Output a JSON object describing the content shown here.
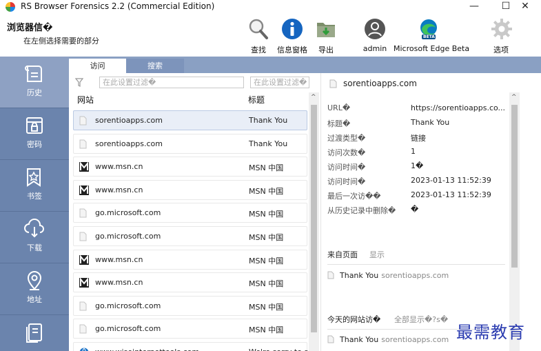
{
  "window": {
    "title": "RS Browser Forensics 2.2 (Commercial Edition)",
    "min_label": "—",
    "max_label": "☐",
    "close_label": "✕"
  },
  "header": {
    "title": "浏览器信�",
    "subtitle": "在左侧选择需要的部分"
  },
  "toolbar": {
    "find": "查找",
    "info_pane": "信息窗格",
    "export": "导出",
    "user": "admin",
    "browser": "Microsoft Edge Beta",
    "options": "选项",
    "browser_badge": "BETA"
  },
  "sidebar": {
    "items": [
      {
        "label": "历史",
        "icon": "history-icon"
      },
      {
        "label": "密码",
        "icon": "password-icon"
      },
      {
        "label": "书签",
        "icon": "bookmark-icon"
      },
      {
        "label": "下载",
        "icon": "download-icon"
      },
      {
        "label": "地址",
        "icon": "location-icon"
      },
      {
        "label": "",
        "icon": "document-icon"
      }
    ]
  },
  "tabs": [
    {
      "label": "访问"
    },
    {
      "label": "搜索"
    }
  ],
  "list": {
    "filter_placeholder_url": "在此设置过滤�",
    "filter_placeholder_title": "在此设置过滤�",
    "col_url": "网站",
    "col_title": "标题",
    "rows": [
      {
        "url": "sorentioapps.com",
        "title": "Thank You",
        "favicon": "blank"
      },
      {
        "url": "sorentioapps.com",
        "title": "Thank You",
        "favicon": "blank"
      },
      {
        "url": "www.msn.cn",
        "title": "MSN 中国",
        "favicon": "msn"
      },
      {
        "url": "www.msn.cn",
        "title": "MSN 中国",
        "favicon": "msn"
      },
      {
        "url": "go.microsoft.com",
        "title": "MSN 中国",
        "favicon": "blank"
      },
      {
        "url": "go.microsoft.com",
        "title": "MSN 中国",
        "favicon": "blank"
      },
      {
        "url": "www.msn.cn",
        "title": "MSN 中国",
        "favicon": "msn"
      },
      {
        "url": "www.msn.cn",
        "title": "MSN 中国",
        "favicon": "msn"
      },
      {
        "url": "go.microsoft.com",
        "title": "MSN 中国",
        "favicon": "blank"
      },
      {
        "url": "go.microsoft.com",
        "title": "MSN 中国",
        "favicon": "blank"
      },
      {
        "url": "www.wiseinternettools.com",
        "title": "We're sorry to se",
        "favicon": "globe"
      }
    ]
  },
  "detail": {
    "header": "sorentioapps.com",
    "props": [
      {
        "label": "URL�",
        "value": "https://sorentioapps.co..."
      },
      {
        "label": "标题�",
        "value": "Thank You"
      },
      {
        "label": "过渡类型�",
        "value": "链接"
      },
      {
        "label": "访问次数�",
        "value": "1"
      },
      {
        "label": "访问时间�",
        "value": "1�"
      },
      {
        "label": "访问时间�",
        "value": "2023-01-13 11:52:39"
      },
      {
        "label": "最后一次访��",
        "value": "2023-01-13 11:52:39"
      },
      {
        "label": "从历史记录中删除�",
        "value": "�"
      }
    ],
    "from_page": {
      "title": "来自页面",
      "link": "显示"
    },
    "from_item": {
      "title": "Thank You",
      "sub": "sorentioapps.com"
    },
    "today": {
      "title": "今天的网站访�",
      "link": "全部显示�?s�"
    },
    "today_item": {
      "title": "Thank You",
      "sub": "sorentioapps.com"
    }
  },
  "watermark": "最需教育",
  "colors": {
    "sidebar": "#6b84ad",
    "sidebar_active": "#8ea1c3",
    "tabbar": "#8aa0c3",
    "selected_row": "#e9eef7"
  }
}
